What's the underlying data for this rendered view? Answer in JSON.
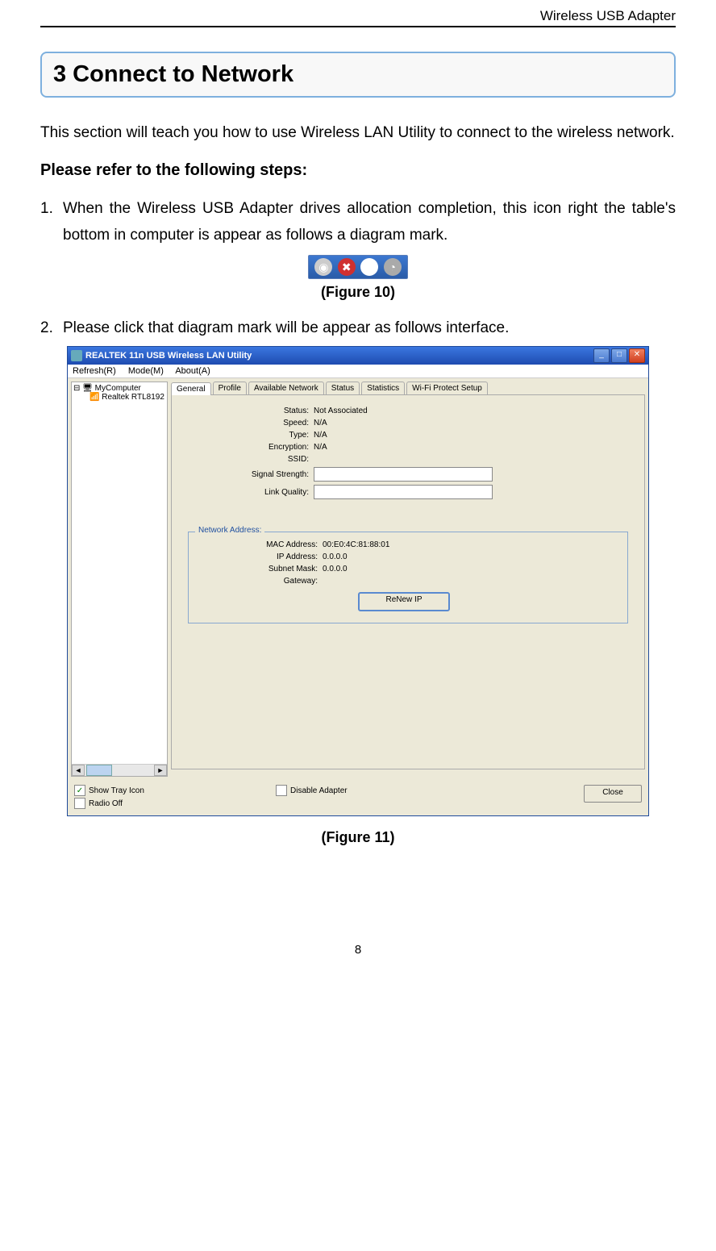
{
  "doc": {
    "header_right": "Wireless USB Adapter",
    "section_title": "3 Connect to Network",
    "intro": "This section will teach you how to use Wireless LAN Utility to connect to the wireless network.",
    "steps_heading": "Please refer to the following steps:",
    "steps": [
      "When the Wireless USB Adapter drives allocation completion, this icon right the table's bottom in computer is appear as follows a diagram mark.",
      "Please click that diagram mark will be appear as follows interface."
    ],
    "figure10": "(Figure 10)",
    "figure11": "(Figure 11)",
    "page_number": "8"
  },
  "window": {
    "title": "REALTEK 11n USB Wireless LAN Utility",
    "menu": [
      "Refresh(R)",
      "Mode(M)",
      "About(A)"
    ],
    "tree": [
      "MyComputer",
      "Realtek RTL8192"
    ],
    "tabs": [
      "General",
      "Profile",
      "Available Network",
      "Status",
      "Statistics",
      "Wi-Fi Protect Setup"
    ],
    "general": {
      "status_label": "Status:",
      "status_value": "Not Associated",
      "speed_label": "Speed:",
      "speed_value": "N/A",
      "type_label": "Type:",
      "type_value": "N/A",
      "encryption_label": "Encryption:",
      "encryption_value": "N/A",
      "ssid_label": "SSID:",
      "ssid_value": "",
      "signal_label": "Signal Strength:",
      "link_label": "Link Quality:"
    },
    "network_address": {
      "legend": "Network Address:",
      "mac_label": "MAC Address:",
      "mac_value": "00:E0:4C:81:88:01",
      "ip_label": "IP Address:",
      "ip_value": "0.0.0.0",
      "subnet_label": "Subnet Mask:",
      "subnet_value": "0.0.0.0",
      "gateway_label": "Gateway:",
      "gateway_value": "",
      "renew_btn": "ReNew IP"
    },
    "bottom": {
      "show_tray": "Show Tray Icon",
      "radio_off": "Radio Off",
      "disable_adapter": "Disable Adapter",
      "close": "Close"
    }
  }
}
